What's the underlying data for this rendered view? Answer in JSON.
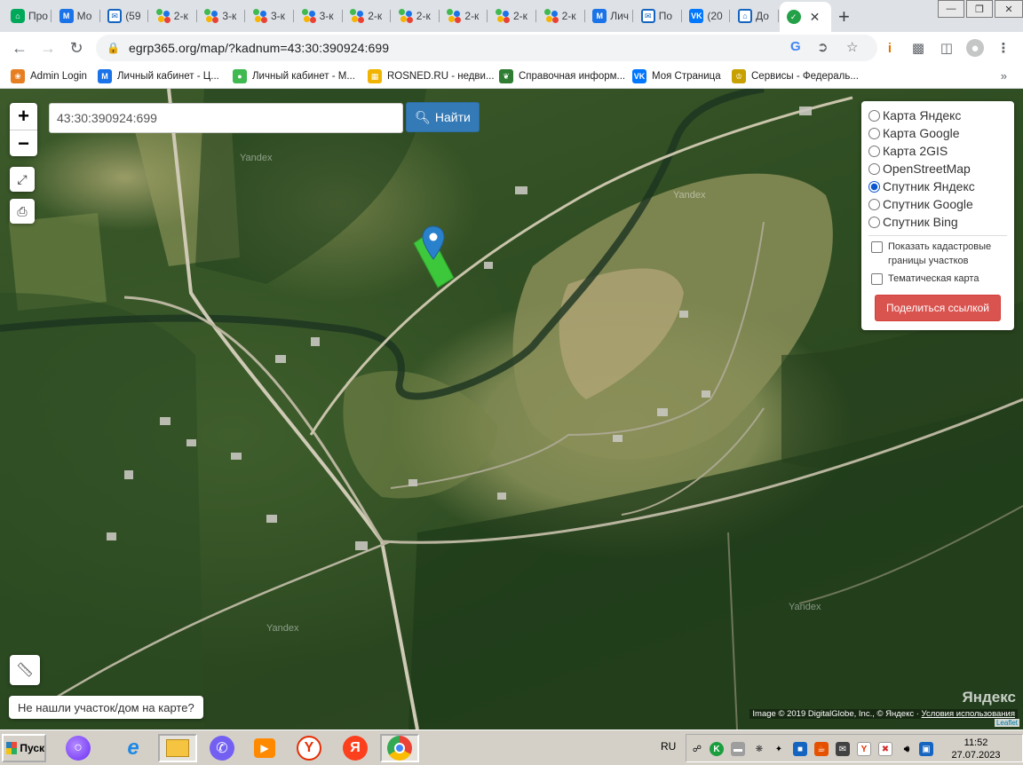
{
  "browser": {
    "tabs": [
      {
        "title": "Про",
        "icon": "house-green-icon"
      },
      {
        "title": "Мо",
        "icon": "m-logo-icon"
      },
      {
        "title": "(59",
        "icon": "mail-icon"
      },
      {
        "title": "2-к",
        "icon": "dots-icon"
      },
      {
        "title": "3-к",
        "icon": "dots-icon"
      },
      {
        "title": "3-к",
        "icon": "dots-icon"
      },
      {
        "title": "3-к",
        "icon": "dots-icon"
      },
      {
        "title": "2-к",
        "icon": "dots-icon"
      },
      {
        "title": "2-к",
        "icon": "dots-icon"
      },
      {
        "title": "2-к",
        "icon": "dots-icon"
      },
      {
        "title": "2-к",
        "icon": "dots-icon"
      },
      {
        "title": "2-к",
        "icon": "dots-icon"
      },
      {
        "title": "Лич",
        "icon": "m-logo-icon"
      },
      {
        "title": "По",
        "icon": "mail-icon"
      },
      {
        "title": "(20",
        "icon": "vk-icon"
      },
      {
        "title": "До",
        "icon": "house-outline-icon"
      },
      {
        "title": "",
        "icon": "check-circle-icon",
        "active": true
      }
    ],
    "new_tab": "+",
    "url": "egrp365.org/map/?kadnum=43:30:390924:699"
  },
  "bookmarks": [
    {
      "label": "Admin Login",
      "icon": "flower-icon",
      "color": "#e67e22"
    },
    {
      "label": "Личный кабинет - Ц...",
      "icon": "m-logo-icon",
      "color": "#1a73e8"
    },
    {
      "label": "Личный кабинет - М...",
      "icon": "dots-icon",
      "color": "#3fb950"
    },
    {
      "label": "ROSNED.RU - недви...",
      "icon": "grid-icon",
      "color": "#f0b400"
    },
    {
      "label": "Справочная информ...",
      "icon": "leaf-icon",
      "color": "#2e7d32"
    },
    {
      "label": "Моя Страница",
      "icon": "vk-icon",
      "color": "#0077ff"
    },
    {
      "label": "Сервисы - Федераль...",
      "icon": "emblem-icon",
      "color": "#c8a000"
    }
  ],
  "bookmarks_more": "»",
  "map": {
    "search_value": "43:30:390924:699",
    "search_button": "Найти",
    "zoom_in": "+",
    "zoom_out": "−",
    "layers": [
      {
        "label": "Карта Яндекс",
        "selected": false
      },
      {
        "label": "Карта Google",
        "selected": false
      },
      {
        "label": "Карта 2GIS",
        "selected": false
      },
      {
        "label": "OpenStreetMap",
        "selected": false
      },
      {
        "label": "Спутник Яндекс",
        "selected": true
      },
      {
        "label": "Спутник Google",
        "selected": false
      },
      {
        "label": "Спутник Bing",
        "selected": false
      }
    ],
    "show_cadastral": "Показать кадастровые границы участков",
    "thematic_map": "Тематическая карта",
    "share_button": "Поделиться ссылкой",
    "not_found": "Не нашли участок/дом на карте?",
    "watermark": "Yandex",
    "yandex_logo": "Яндекс",
    "attribution": "Image © 2019 DigitalGlobe, Inc., © Яндекс",
    "terms_link": "Условия использования",
    "leaflet": "Leaflet"
  },
  "taskbar": {
    "start": "Пуск",
    "language": "RU",
    "time": "11:52",
    "date": "27.07.2023"
  }
}
